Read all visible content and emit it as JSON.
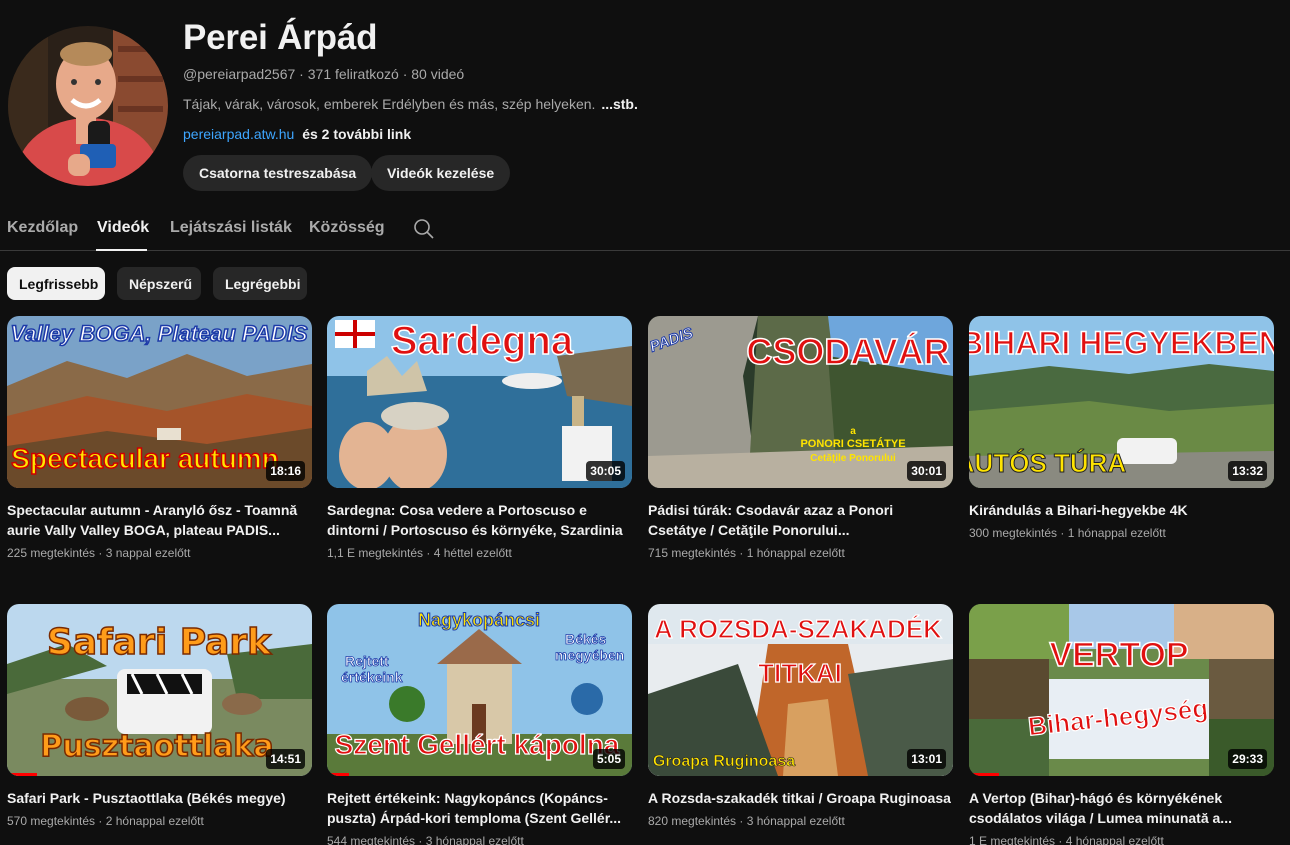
{
  "channel": {
    "name": "Perei Árpád",
    "handle": "@pereiarpad2567",
    "subscribers": "371 feliratkozó",
    "video_count": "80 videó",
    "meta_sep": " · ",
    "description": "Tájak, várak, városok, emberek Erdélyben és más, szép helyeken.",
    "description_more": "...stb.",
    "link": "pereiarpad.atw.hu",
    "more_links": "és 2 további link",
    "customize_label": "Csatorna testreszabása",
    "manage_label": "Videók kezelése"
  },
  "tabs": [
    {
      "label": "Kezdőlap",
      "active": false
    },
    {
      "label": "Videók",
      "active": true
    },
    {
      "label": "Lejátszási listák",
      "active": false
    },
    {
      "label": "Közösség",
      "active": false
    }
  ],
  "filters": [
    {
      "label": "Legfrissebb",
      "active": true
    },
    {
      "label": "Népszerű",
      "active": false
    },
    {
      "label": "Legrégebbi",
      "active": false
    }
  ],
  "videos": [
    {
      "title": "Spectacular autumn - Aranyló ősz - Toamnă aurie Vally Valley BOGA, plateau PADIS...",
      "views": "225 megtekintés",
      "age": "3 nappal ezelőtt",
      "duration": "18:16",
      "thumb_top": "Valley BOGA, Plateau PADIS",
      "thumb_bottom": "Spectacular autumn"
    },
    {
      "title": "Sardegna: Cosa vedere a Portoscuso e dintorni / Portoscuso és környéke, Szardinia",
      "views": "1,1 E megtekintés",
      "age": "4 héttel ezelőtt",
      "duration": "30:05",
      "thumb_top": "Sardegna",
      "thumb_bottom": ""
    },
    {
      "title": "Pádisi túrák: Csodavár azaz a Ponori Csetátye / Cetăţile Ponorului...",
      "views": "715 megtekintés",
      "age": "1 hónappal ezelőtt",
      "duration": "30:01",
      "thumb_top": "CSODAVÁR",
      "thumb_bottom": "PONORI CSETÁTYE",
      "thumb_corner": "PADIS",
      "thumb_sub": "Cetăţile Ponorului",
      "thumb_a": "a"
    },
    {
      "title": "Kirándulás a Bihari-hegyekbe 4K",
      "views": "300 megtekintés",
      "age": "1 hónappal ezelőtt",
      "duration": "13:32",
      "thumb_top": "BIHARI HEGYEKBEN",
      "thumb_bottom": "AUTÓS TÚRA"
    },
    {
      "title": "Safari Park - Pusztaottlaka (Békés megye)",
      "views": "570 megtekintés",
      "age": "2 hónappal ezelőtt",
      "duration": "14:51",
      "thumb_top": "Safari Park",
      "thumb_bottom": "Pusztaottlaka"
    },
    {
      "title": "Rejtett értékeink: Nagykopáncs (Kopáncs-puszta) Árpád-kori temploma (Szent Gellér...",
      "views": "544 megtekintés",
      "age": "3 hónappal ezelőtt",
      "duration": "5:05",
      "thumb_top": "Nagykopáncsi",
      "thumb_bottom": "Szent Gellért kápolna",
      "thumb_left1": "Rejtett",
      "thumb_left2": "értékeink",
      "thumb_right1": "Békés",
      "thumb_right2": "megyében"
    },
    {
      "title": "A Rozsda-szakadék titkai / Groapa Ruginoasa",
      "views": "820 megtekintés",
      "age": "3 hónappal ezelőtt",
      "duration": "13:01",
      "thumb_top": "A ROZSDA-SZAKADÉK",
      "thumb_mid": "TITKAI",
      "thumb_bottom": "Groapa Ruginoasa"
    },
    {
      "title": "A Vertop (Bihar)-hágó és környékének csodálatos világa / Lumea minunată a...",
      "views": "1 E megtekintés",
      "age": "4 hónappal ezelőtt",
      "duration": "29:33",
      "thumb_top": "VERTOP",
      "thumb_bottom": "Bihar-hegység"
    }
  ],
  "colors": {
    "accent": "#3ea6ff",
    "progress": "#ff0000",
    "background": "#0f0f0f"
  }
}
